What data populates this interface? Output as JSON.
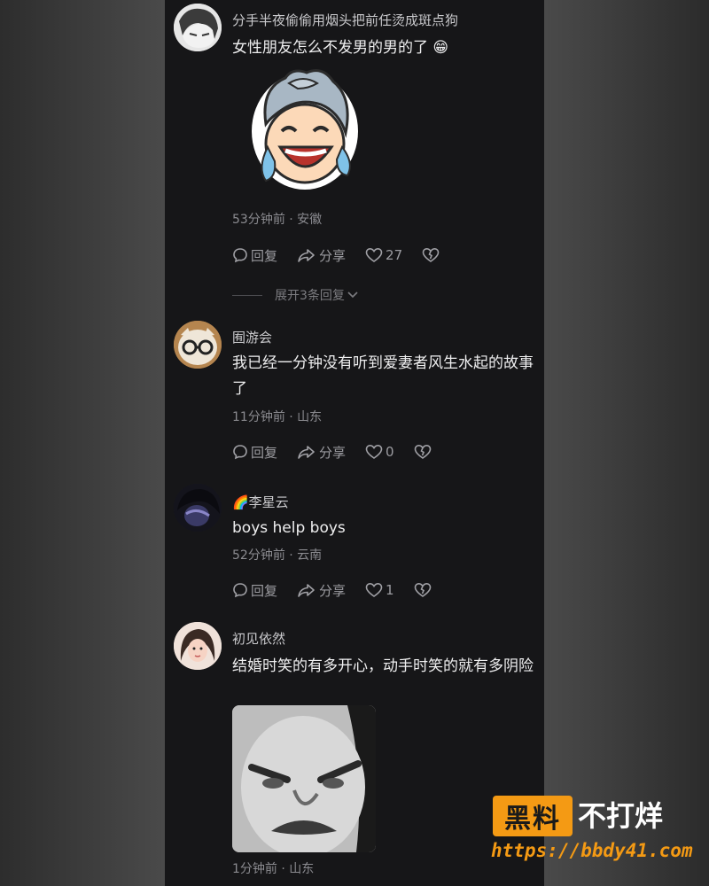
{
  "comments": [
    {
      "username": "分手半夜偷偷用烟头把前任烫成斑点狗",
      "text": "女性朋友怎么不发男的男的了",
      "emoji": "😁",
      "meta": "53分钟前 · 安徽",
      "reply_label": "回复",
      "share_label": "分享",
      "likes": "27",
      "expand_label": "展开3条回复"
    },
    {
      "username": "囿游会",
      "text": "我已经一分钟没有听到爱妻者风生水起的故事了",
      "meta": "11分钟前 · 山东",
      "reply_label": "回复",
      "share_label": "分享",
      "likes": "0"
    },
    {
      "username": "🌈李星云",
      "text": "boys help boys",
      "meta": "52分钟前 · 云南",
      "reply_label": "回复",
      "share_label": "分享",
      "likes": "1"
    },
    {
      "username": "初见依然",
      "text": "结婚时笑的有多开心，动手时笑的就有多阴险",
      "meta": "1分钟前 · 山东"
    }
  ],
  "watermark": {
    "badge": "黑料",
    "text": "不打烊",
    "url": "https://bbdy41.com",
    "accent_color": "#f49a14"
  }
}
